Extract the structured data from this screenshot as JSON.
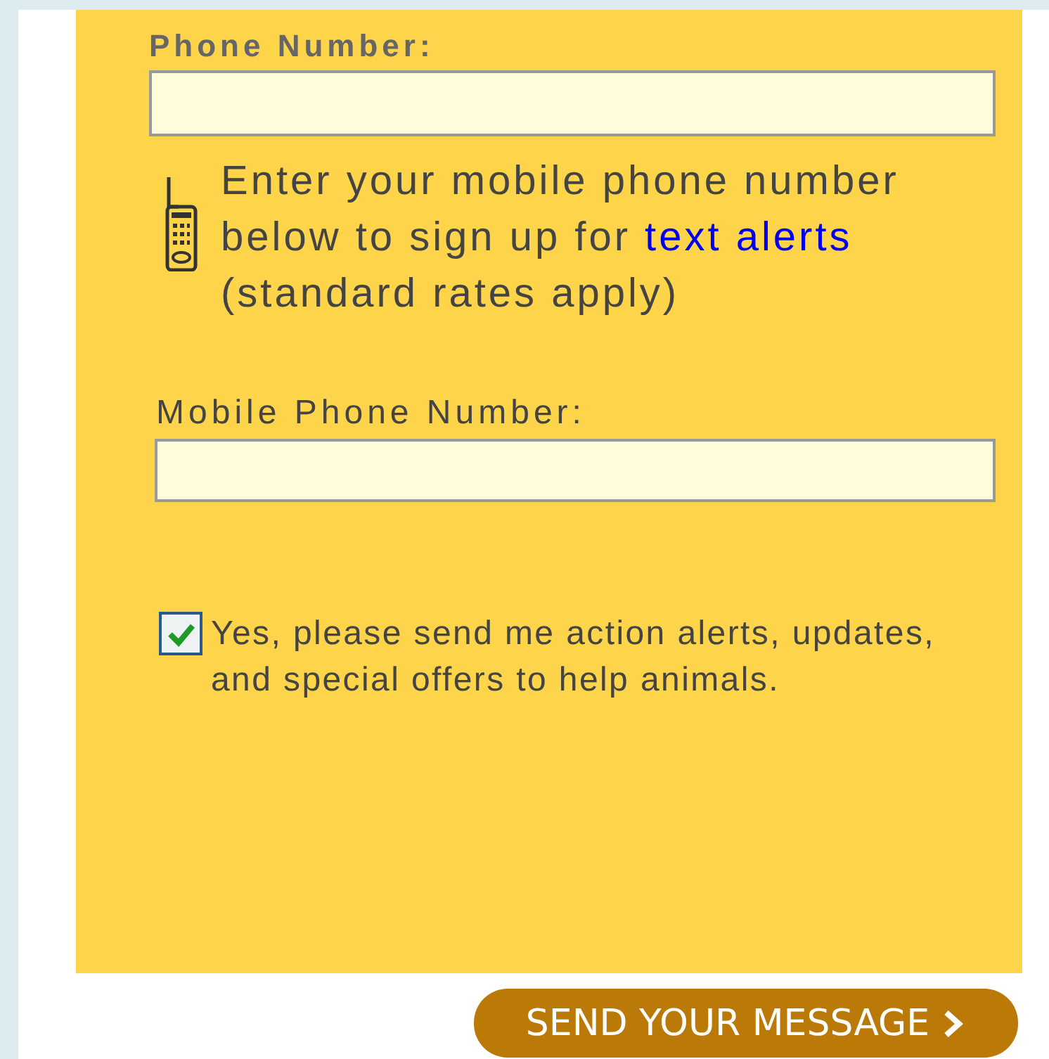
{
  "phone": {
    "label": "Phone Number:"
  },
  "sms_note": {
    "before": "Enter your mobile phone number below to sign up for ",
    "link": "text alerts",
    "after": " (standard rates apply)"
  },
  "mobile": {
    "label": "Mobile Phone Number:"
  },
  "opt_in": {
    "label": "Yes, please send me action alerts, updates, and special offers to help animals.",
    "checked": true
  },
  "submit": {
    "label": "SEND YOUR MESSAGE"
  }
}
